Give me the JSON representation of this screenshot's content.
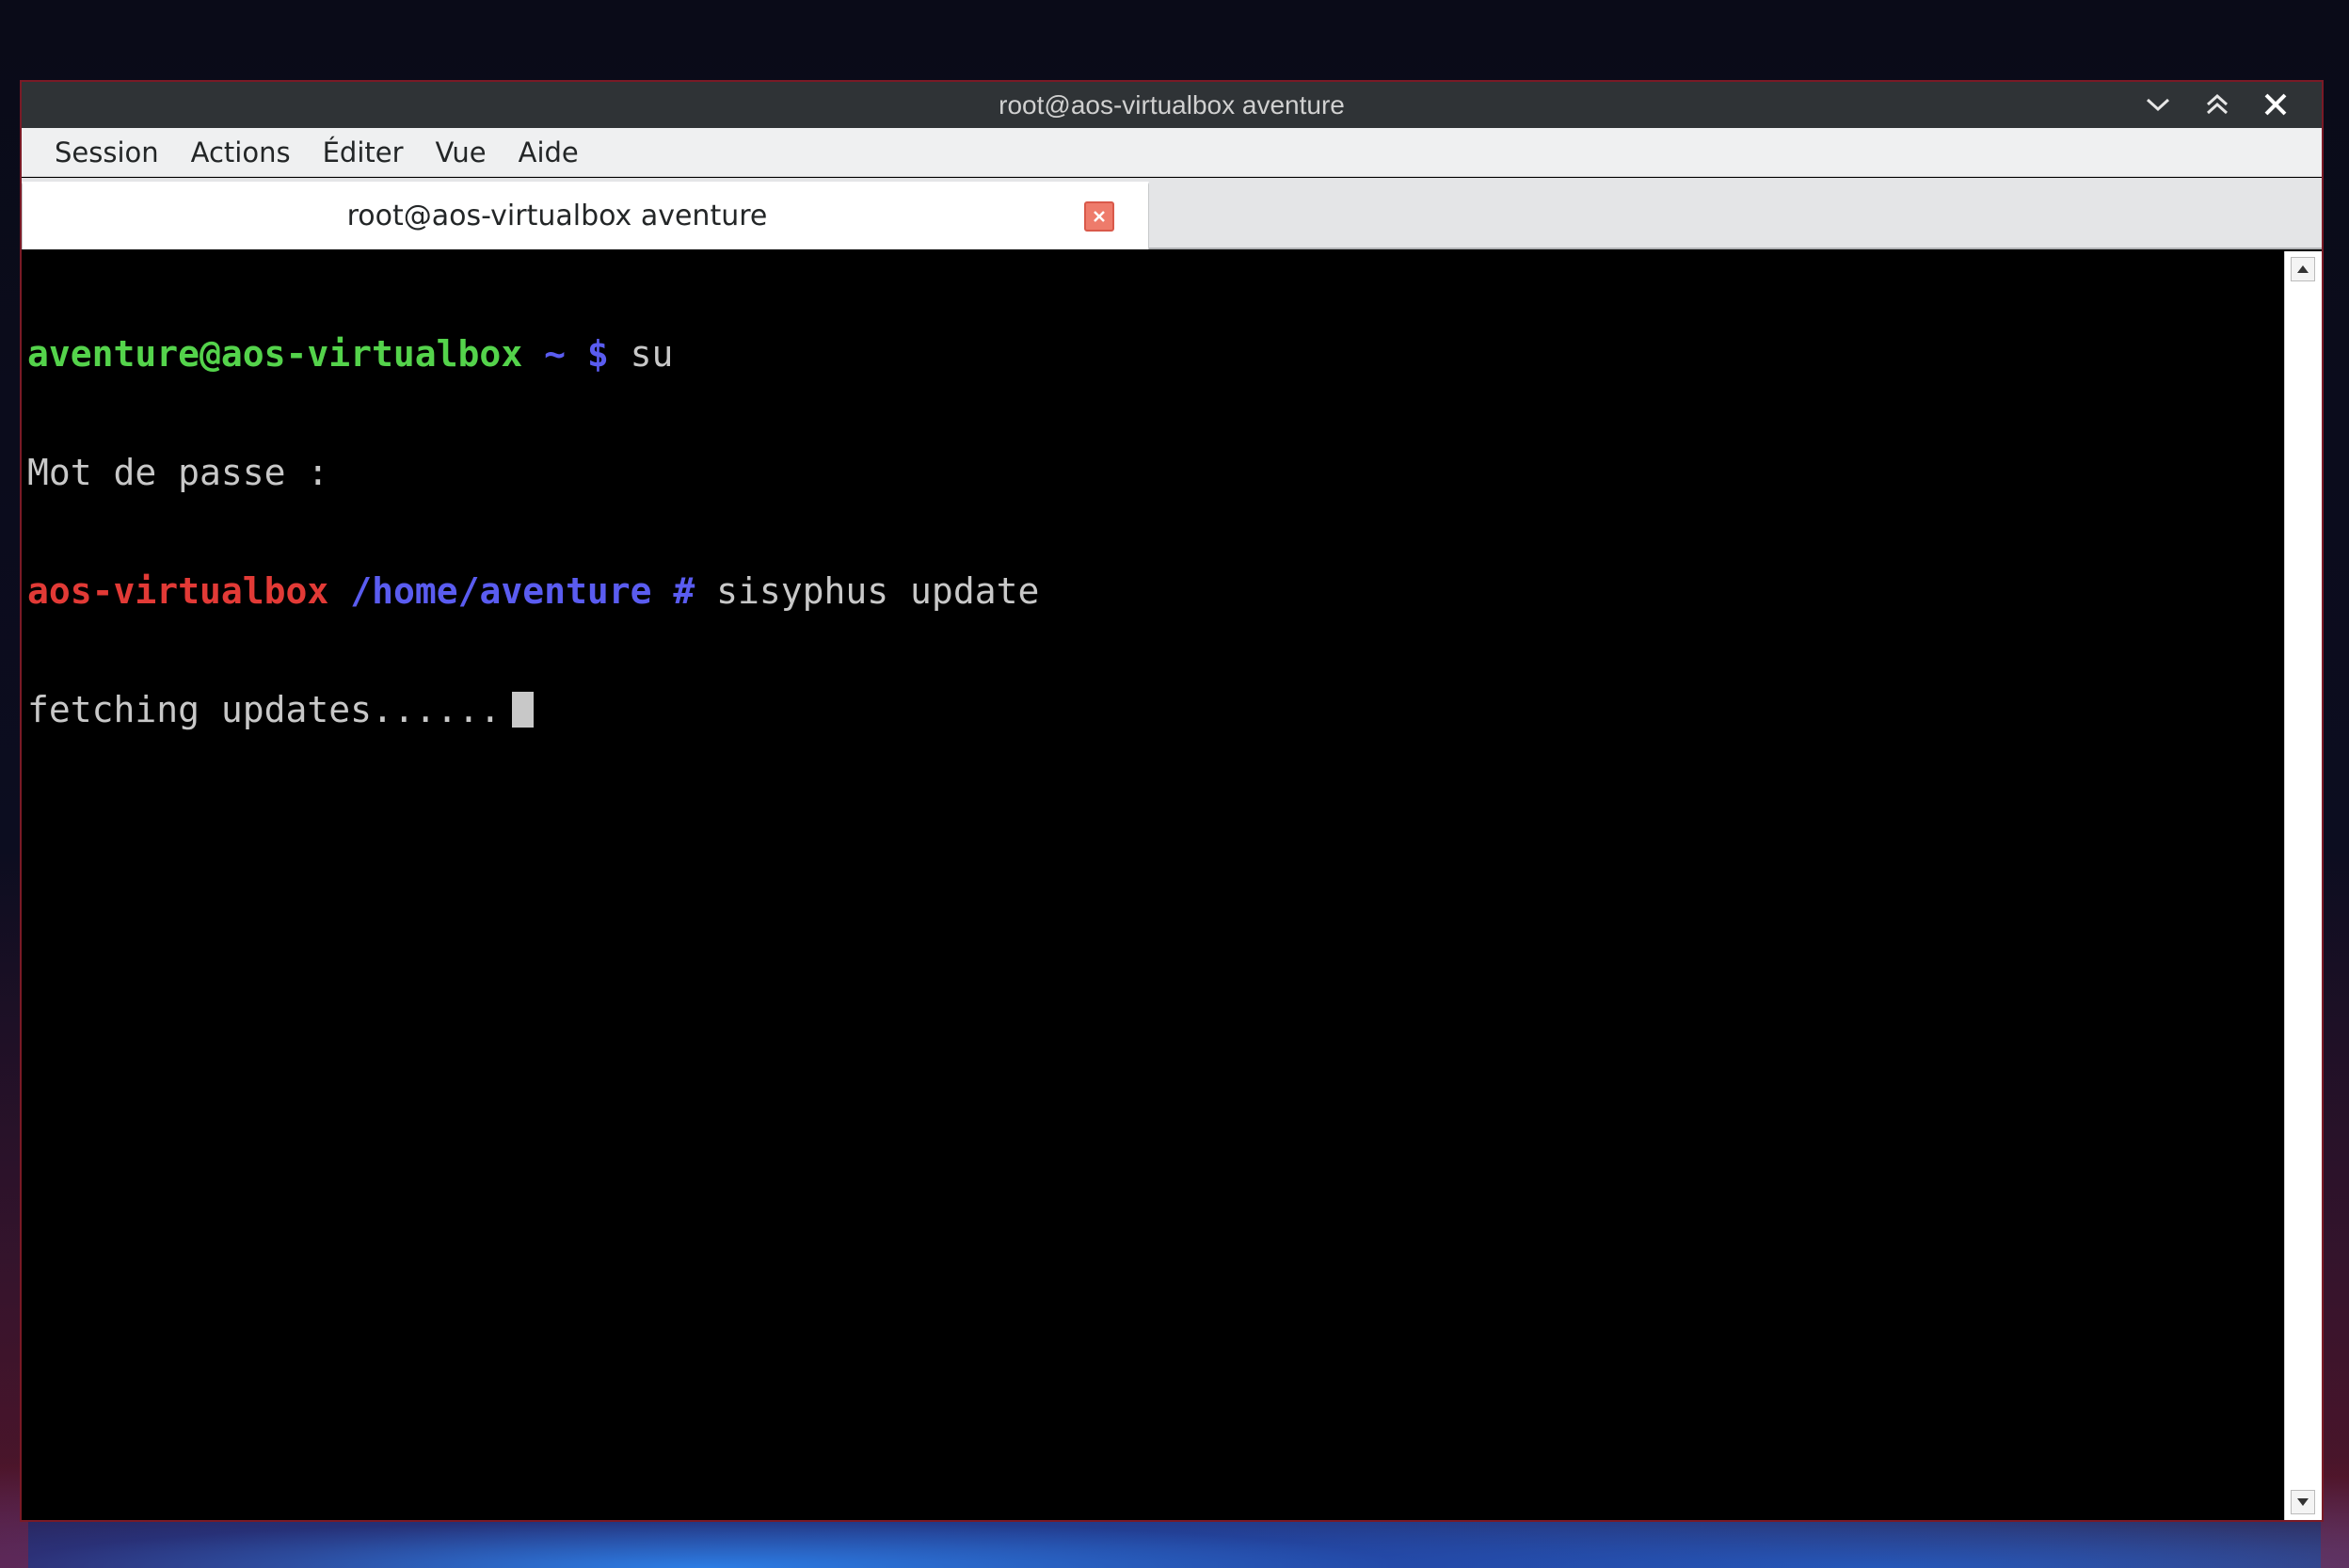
{
  "window": {
    "title": "root@aos-virtualbox aventure",
    "controls": [
      "chevron-down-icon",
      "double-chevron-up-icon",
      "close-icon"
    ]
  },
  "menubar": {
    "items": [
      {
        "label": "Session"
      },
      {
        "label": "Actions"
      },
      {
        "label": "Éditer"
      },
      {
        "label": "Vue"
      },
      {
        "label": "Aide"
      }
    ]
  },
  "tab": {
    "label": "root@aos-virtualbox aventure"
  },
  "terminal": {
    "line1": {
      "user_host": "aventure@aos-virtualbox",
      "path": "~",
      "prompt": "$",
      "command": "su"
    },
    "line2": {
      "text": "Mot de passe :"
    },
    "line3": {
      "host": "aos-virtualbox",
      "path": "/home/aventure",
      "prompt": "#",
      "command": "sisyphus update"
    },
    "line4": {
      "text": "fetching updates......"
    }
  },
  "colors": {
    "user_green": "#54d34b",
    "root_red": "#e23a36",
    "path_blue": "#5a5cf0",
    "text_gray": "#c8c8c8",
    "window_border": "#7a1a26"
  }
}
